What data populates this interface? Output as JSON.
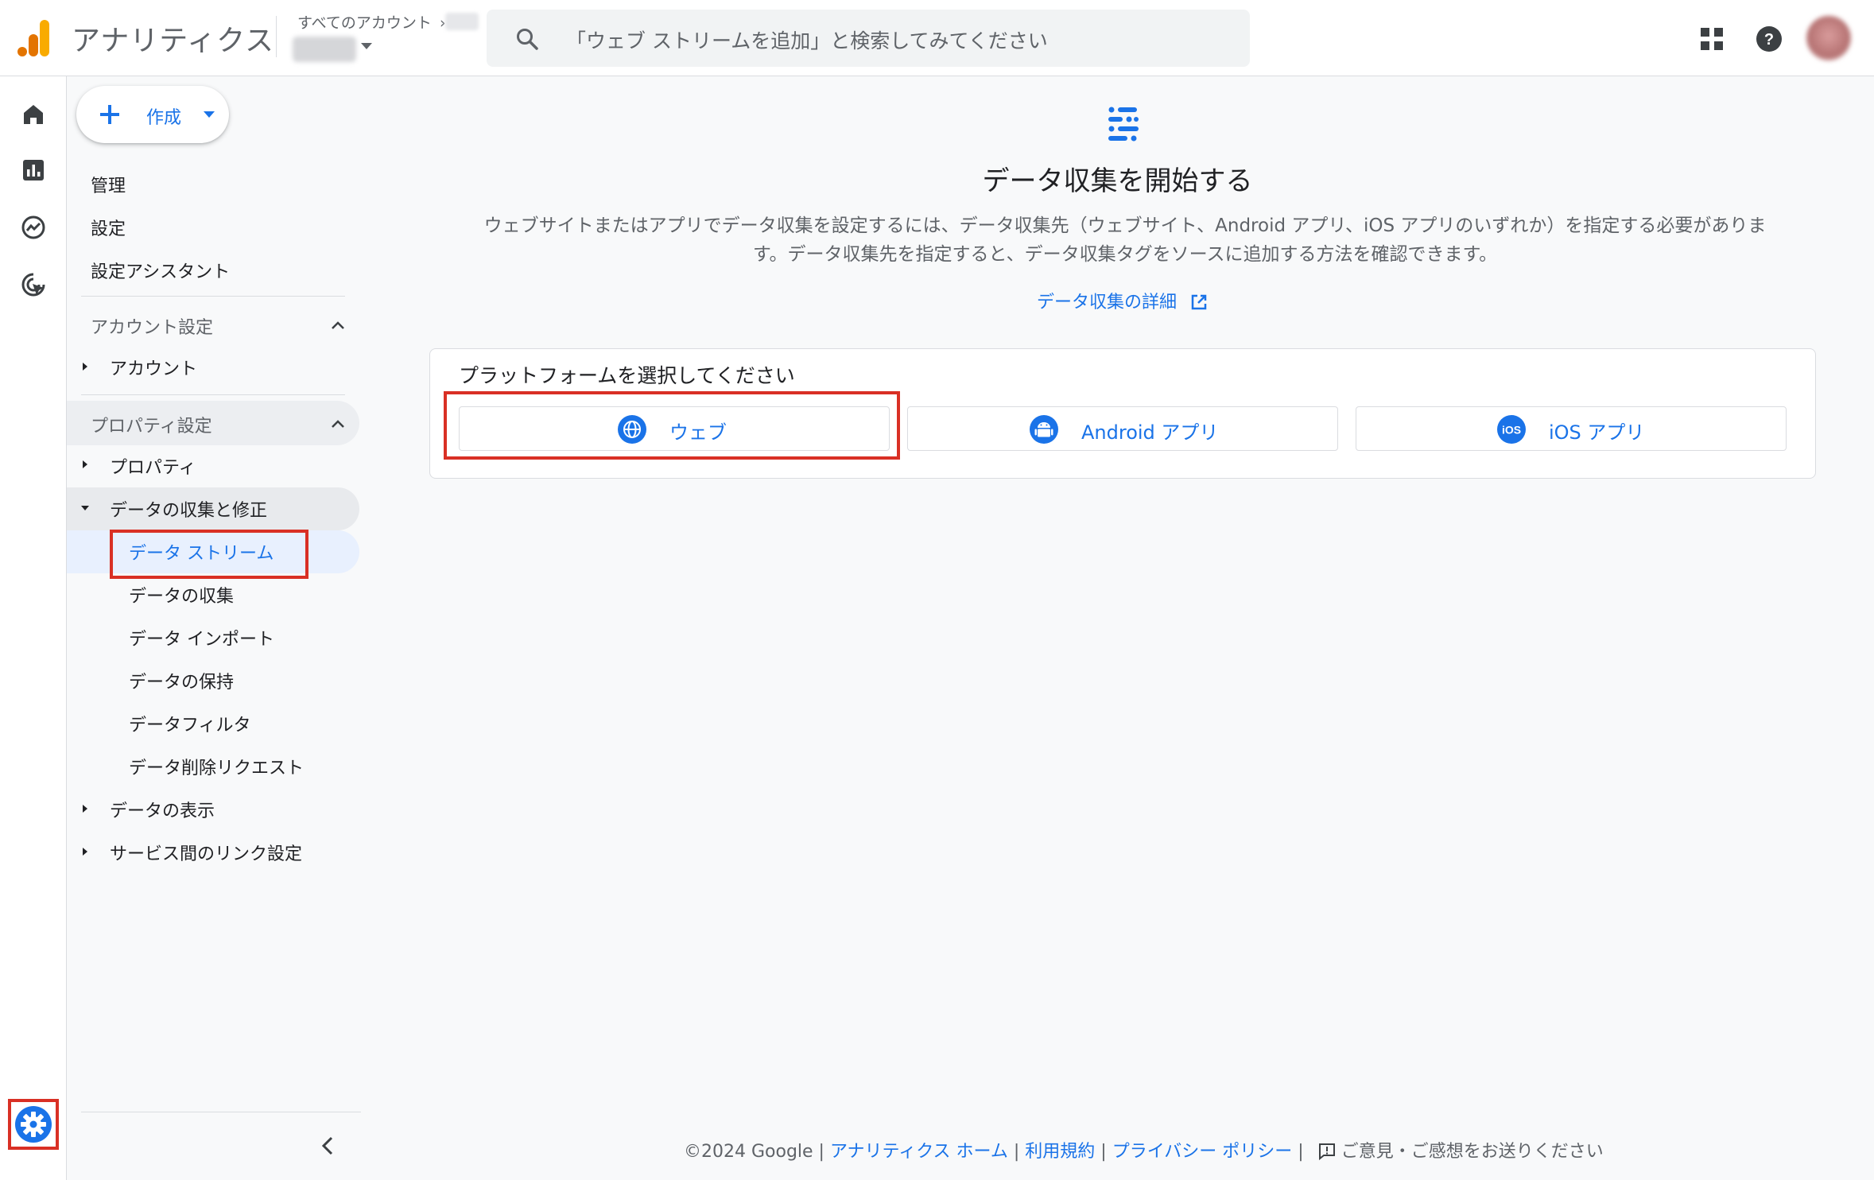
{
  "header": {
    "app_title": "アナリティクス",
    "account_path": "すべてのアカウント",
    "search_placeholder": "「ウェブ ストリームを追加」と検索してみてください"
  },
  "rail": {
    "icons": [
      "home-icon",
      "reports-icon",
      "explore-icon",
      "advertising-icon"
    ],
    "settings_icon": "gear-icon"
  },
  "nav": {
    "create_label": "作成",
    "top_items": [
      "管理",
      "設定",
      "設定アシスタント"
    ],
    "account_section": {
      "label": "アカウント設定",
      "items": [
        "アカウント"
      ]
    },
    "property_section": {
      "label": "プロパティ設定",
      "property": "プロパティ",
      "data_collection_group": "データの収集と修正",
      "data_collection_items": [
        "データ ストリーム",
        "データの収集",
        "データ インポート",
        "データの保持",
        "データフィルタ",
        "データ削除リクエスト"
      ],
      "data_display": "データの表示",
      "service_links": "サービス間のリンク設定"
    }
  },
  "main": {
    "title": "データ収集を開始する",
    "description": "ウェブサイトまたはアプリでデータ収集を設定するには、データ収集先（ウェブサイト、Android アプリ、iOS アプリのいずれか）を指定する必要があります。データ収集先を指定すると、データ収集タグをソースに追加する方法を確認できます。",
    "learn_more": "データ収集の詳細",
    "platform_prompt": "プラットフォームを選択してください",
    "platforms": [
      {
        "label": "ウェブ",
        "icon": "globe-icon"
      },
      {
        "label": "Android アプリ",
        "icon": "android-icon"
      },
      {
        "label": "iOS アプリ",
        "icon": "ios-icon"
      }
    ]
  },
  "footer": {
    "copyright": "©2024 Google",
    "links": [
      "アナリティクス ホーム",
      "利用規約",
      "プライバシー ポリシー"
    ],
    "feedback": "ご意見・ご感想をお送りください"
  },
  "colors": {
    "accent": "#1a73e8",
    "highlight": "#d93025",
    "logo_orange": "#f9ab00",
    "logo_dark": "#e37400"
  }
}
